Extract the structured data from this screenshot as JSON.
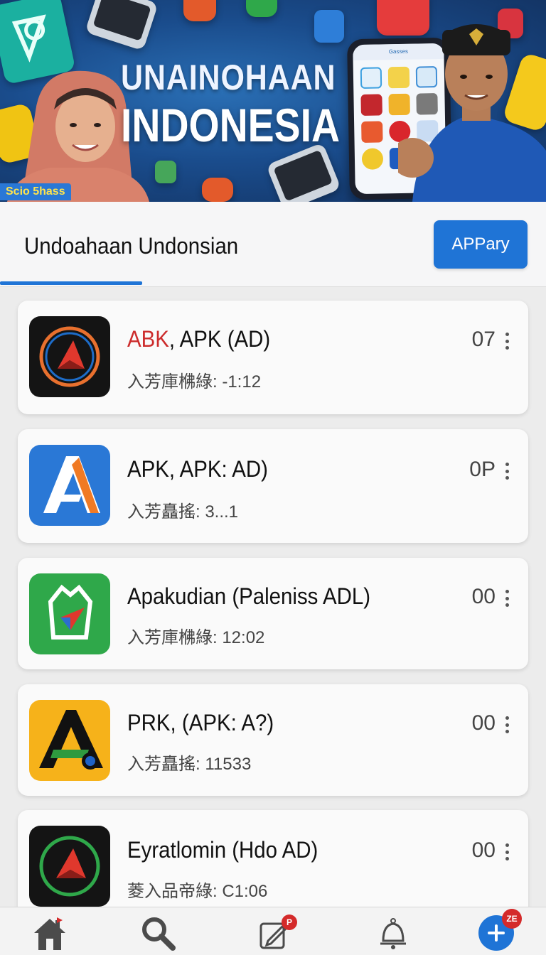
{
  "banner": {
    "title_line1": "UNAINOHAAN",
    "title_line2": "INDONESIA",
    "corner_tag": "Scio 5hass",
    "phone_header": "Gasses"
  },
  "header": {
    "title": "Undoahaan Undonsian",
    "action_button": "APPary"
  },
  "apps": [
    {
      "name_red": "ABK",
      "name_rest": ", APK (AD)",
      "meta": "入芳庫梻綠: -1:12",
      "count": "07",
      "icon": "red-triangle-ring-icon",
      "bg": "#141414"
    },
    {
      "name_red": "",
      "name_rest": "APK, APK: AD)",
      "meta": "入芳矗搖: 3...1",
      "count": "0P",
      "icon": "letter-a-icon",
      "bg": "#2a78d6"
    },
    {
      "name_red": "",
      "name_rest": "Apakudian (Paleniss ADL)",
      "meta": "入芳庫梻綠: 12:02",
      "count": "00",
      "icon": "recycle-arrow-icon",
      "bg": "#2fa84a"
    },
    {
      "name_red": "",
      "name_rest": "PRK, (APK: A?)",
      "meta": "入芳矗搖: 11533",
      "count": "00",
      "icon": "letter-a-lens-icon",
      "bg": "#f6b21a"
    },
    {
      "name_red": "",
      "name_rest": "Eyratlomin (Hdo AD)",
      "meta": "菱入品帝綠: C1:06",
      "count": "00",
      "icon": "red-triangle-green-ring-icon",
      "bg": "#141414"
    }
  ],
  "nav": {
    "edit_badge": "P",
    "add_badge": "ZE"
  },
  "colors": {
    "accent": "#1f74d6",
    "badge": "#d42a2a"
  }
}
